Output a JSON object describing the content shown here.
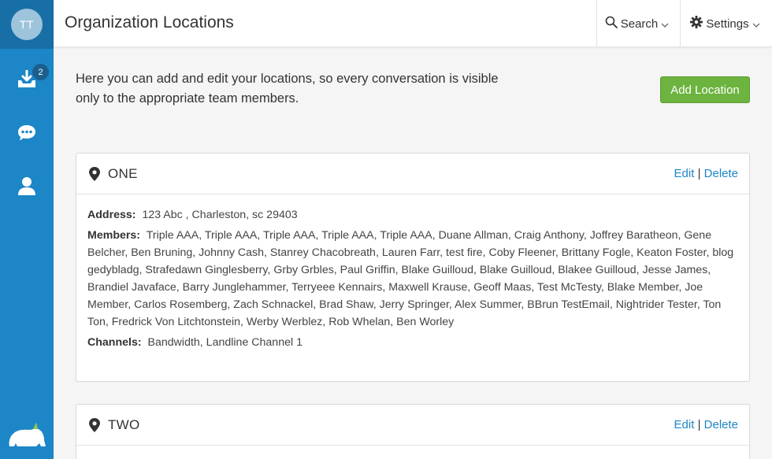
{
  "app": {
    "avatar_initials": "TT",
    "inbox_badge": "2",
    "logo_text": "rhinogram"
  },
  "header": {
    "title": "Organization Locations",
    "search_label": "Search",
    "settings_label": "Settings"
  },
  "intro": {
    "text": "Here you can add and edit your locations, so every conversation is visible only to the appropriate team members."
  },
  "add_location_label": "Add Location",
  "actions": {
    "edit": "Edit",
    "separator": "|",
    "delete": "Delete"
  },
  "labels": {
    "address": "Address:",
    "members": "Members:",
    "channels": "Channels:"
  },
  "locations": [
    {
      "name": "ONE",
      "address": "123 Abc , Charleston, sc 29403",
      "members": "Triple AAA, Triple AAA, Triple AAA, Triple AAA, Triple AAA, Duane Allman, Craig Anthony, Joffrey Baratheon, Gene Belcher, Ben Bruning, Johnny Cash, Stanrey Chacobreath, Lauren Farr, test fire, Coby Fleener, Brittany Fogle, Keaton Foster, blog gedybladg, Strafedawn Ginglesberry, Grby Grbles, Paul Griffin, Blake Guilloud, Blake Guilloud, Blakee Guilloud, Jesse James, Brandiel Javaface, Barry Junglehammer, Terryeee Kennairs, Maxwell Krause, Geoff Maas, Test McTesty, Blake Member, Joe Member, Carlos Rosemberg, Zach Schnackel, Brad Shaw, Jerry Springer, Alex Summer, BBrun TestEmail, Nightrider Tester, Ton Ton, Fredrick Von Litchtonstein, Werby Werblez, Rob Whelan, Ben Worley",
      "channels": "Bandwidth, Landline Channel 1"
    },
    {
      "name": "TWO"
    }
  ],
  "colors": {
    "sidebar": "#1c86c7",
    "accent_link": "#1c86c7",
    "add_button": "#6cb33f"
  }
}
